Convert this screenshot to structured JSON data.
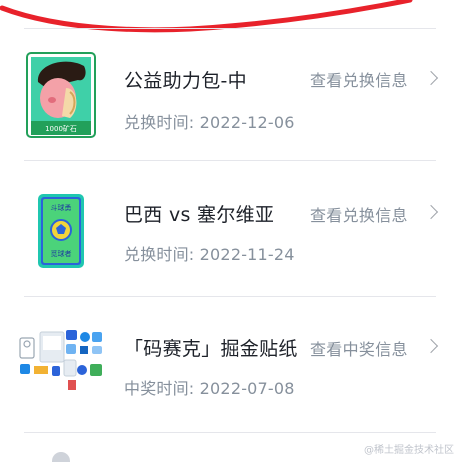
{
  "items": [
    {
      "title": "公益助力包-中",
      "date": "兑换时间: 2022-12-06",
      "link": "查看兑换信息",
      "badge": "1000矿石",
      "icon": "character-pack-icon"
    },
    {
      "title": "巴西 vs 塞尔维亚",
      "date": "兑换时间: 2022-11-24",
      "link": "查看兑换信息",
      "card_top": "斗球勇",
      "card_bottom": "觅球者",
      "icon": "football-card-icon"
    },
    {
      "title": "「码赛克」掘金贴纸",
      "date": "中奖时间: 2022-07-08",
      "link": "查看中奖信息",
      "icon": "sticker-set-icon"
    }
  ],
  "watermark": "@稀土掘金技术社区",
  "colors": {
    "scribble": "#e8222b",
    "title": "#1d2129",
    "secondary": "#86909c",
    "divider": "#e5e6eb",
    "badge_green": "#22a05a",
    "card_teal": "#1fc7b0"
  }
}
